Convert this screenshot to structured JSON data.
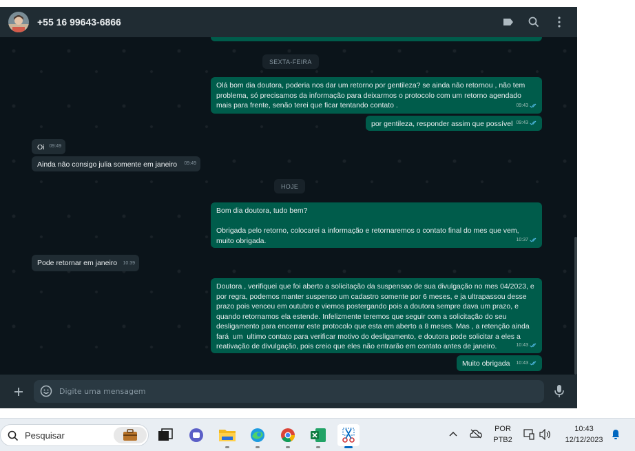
{
  "header": {
    "contact_name": "+55 16 99643-6866",
    "icons": [
      "label-icon",
      "search-icon",
      "menu-icon"
    ]
  },
  "date_chips": {
    "friday": "SEXTA-FEIRA",
    "today": "HOJE"
  },
  "messages": [
    {
      "direction": "out",
      "text": "Olá bom dia doutora, poderia nos dar um retorno por gentileza? se ainda não retornou , não tem problema, só precisamos da informação para deixarmos o protocolo com um retorno agendado mais para frente, senão terei que ficar tentando contato .",
      "time": "09:43"
    },
    {
      "direction": "out",
      "text": "por gentileza, responder assim que possível",
      "time": "09:43"
    },
    {
      "direction": "in",
      "text": "Oi",
      "time": "09:49"
    },
    {
      "direction": "in",
      "text": "Ainda não consigo julia somente em janeiro",
      "time": "09:49"
    },
    {
      "direction": "out",
      "text": "Bom dia doutora, tudo bem?\n\nObrigada pelo retorno, colocarei a informação e retornaremos o contato final do mes que vem, muito obrigada.",
      "time": "10:37"
    },
    {
      "direction": "in",
      "text": "Pode retornar em janeiro",
      "time": "10:39"
    },
    {
      "direction": "out",
      "text": "Doutora , verifiquei que foi aberto a solicitação da suspensao de sua divulgação no mes 04/2023, e por regra, podemos manter suspenso um cadastro somente por 6 meses, e ja ultrapassou desse prazo pois venceu em outubro e viemos postergando pois a doutora sempre dava um prazo, e quando retornamos ela estende. Infelizmente teremos que seguir com a solicitação do seu desligamento para encerrar este protocolo que esta em aberto a 8 meses. Mas , a retenção ainda fará  um  ultimo contato para verificar motivo do desligamento, e doutora pode solicitar a eles a reativação de divulgação, pois creio que eles não entrarão em contato antes de janeiro.",
      "time": "10:43"
    },
    {
      "direction": "out",
      "text": "Muito obrigada",
      "time": "10:43"
    }
  ],
  "composer": {
    "placeholder": "Digite uma mensagem",
    "icons": [
      "plus-icon",
      "emoji-icon",
      "microphone-icon"
    ]
  },
  "taskbar": {
    "search_label": "Pesquisar",
    "apps": [
      "work-bag-icon",
      "task-view-icon",
      "teams-chat-icon",
      "file-explorer-icon",
      "edge-icon",
      "chrome-icon",
      "excel-icon",
      "snipping-tool-icon"
    ],
    "language_top": "POR",
    "language_bottom": "PTB2",
    "time": "10:43",
    "date": "12/12/2023"
  },
  "colors": {
    "chat_bg": "#0b141a",
    "header_bg": "#202c33",
    "outgoing_bubble": "#005c4b",
    "incoming_bubble": "#202c33",
    "read_ticks": "#53bdeb"
  }
}
